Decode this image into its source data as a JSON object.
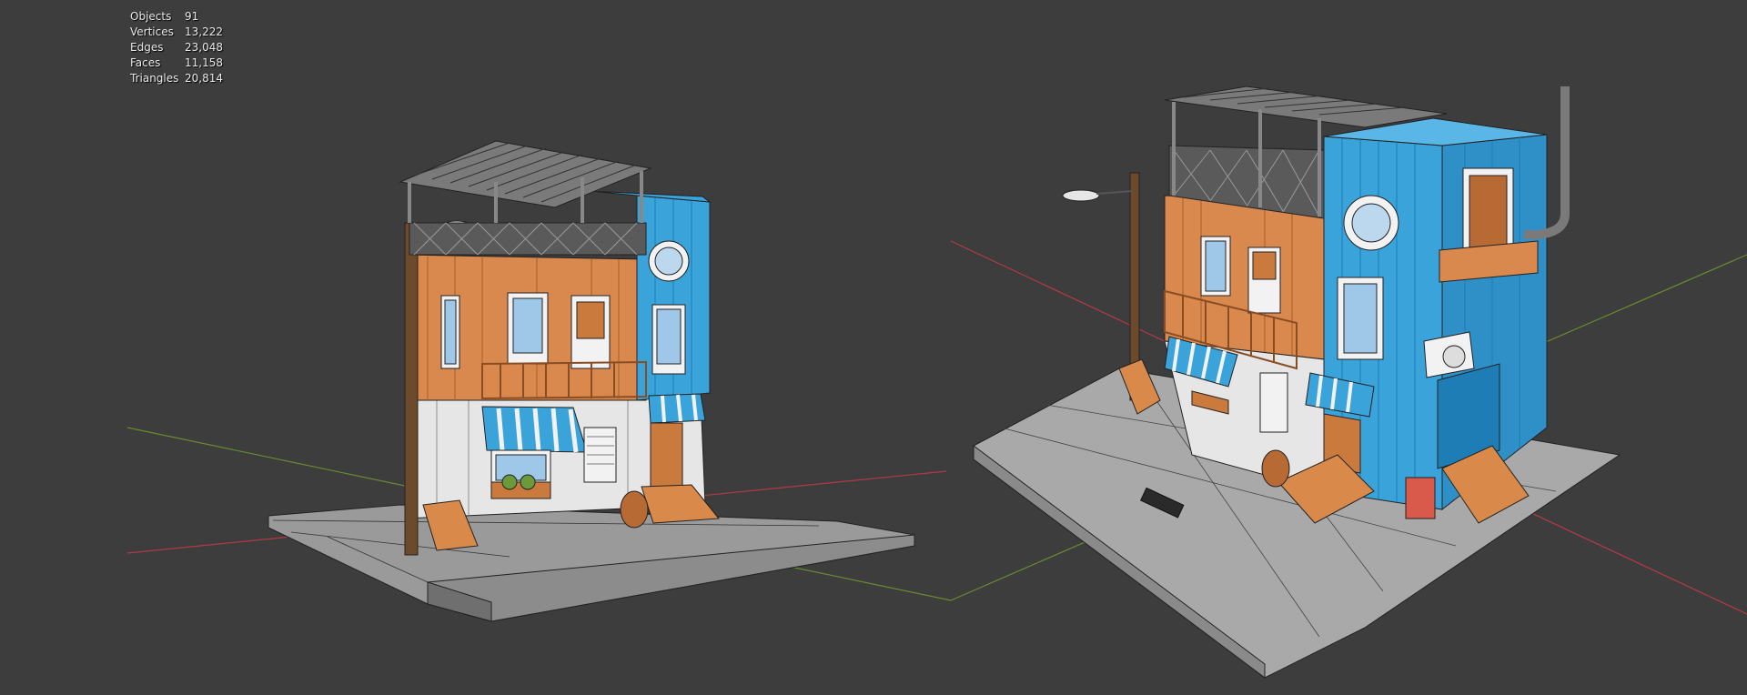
{
  "viewport": {
    "background": "#3d3d3d",
    "x_axis_color": "#b33a48",
    "y_axis_color": "#6a8a2e"
  },
  "stats": {
    "rows": [
      {
        "label": "Objects",
        "value": "91"
      },
      {
        "label": "Vertices",
        "value": "13,222"
      },
      {
        "label": "Edges",
        "value": "23,048"
      },
      {
        "label": "Faces",
        "value": "11,158"
      },
      {
        "label": "Triangles",
        "value": "20,814"
      }
    ]
  },
  "model": {
    "name_icon": "building-model-icon",
    "colors": {
      "orange": "#d9884e",
      "orange_dark": "#b86a35",
      "blue": "#39a3da",
      "blue_dark": "#1f7db5",
      "white": "#e6e6e6",
      "grey_tile": "#a9a9a9",
      "roof_grey": "#8a8a8a",
      "wood": "#c97a3c"
    }
  }
}
